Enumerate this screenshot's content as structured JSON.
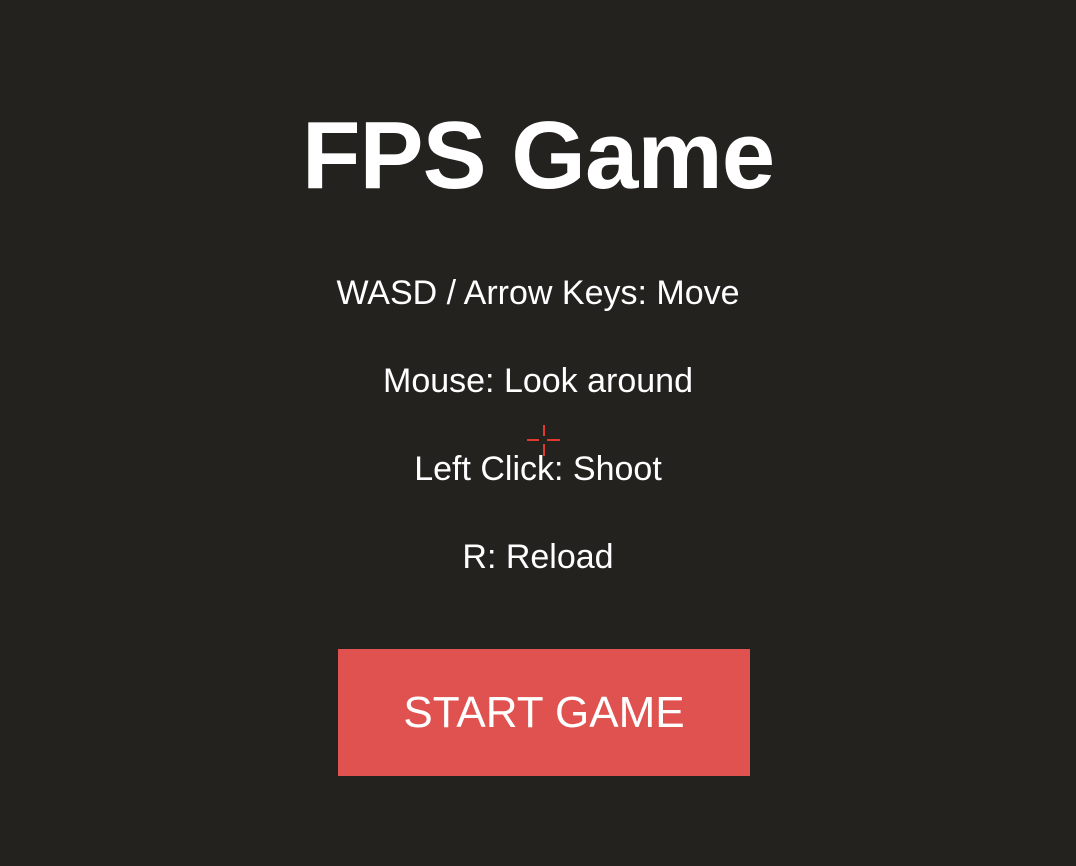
{
  "menu": {
    "title": "FPS Game",
    "instructions": [
      "WASD / Arrow Keys: Move",
      "Mouse: Look around",
      "Left Click: Shoot",
      "R: Reload"
    ],
    "start_button": "START GAME"
  },
  "colors": {
    "background": "#24221f",
    "accent": "#e05250",
    "crosshair": "#e0392f",
    "text": "#ffffff"
  },
  "icons": {
    "crosshair": "crosshair-icon"
  }
}
